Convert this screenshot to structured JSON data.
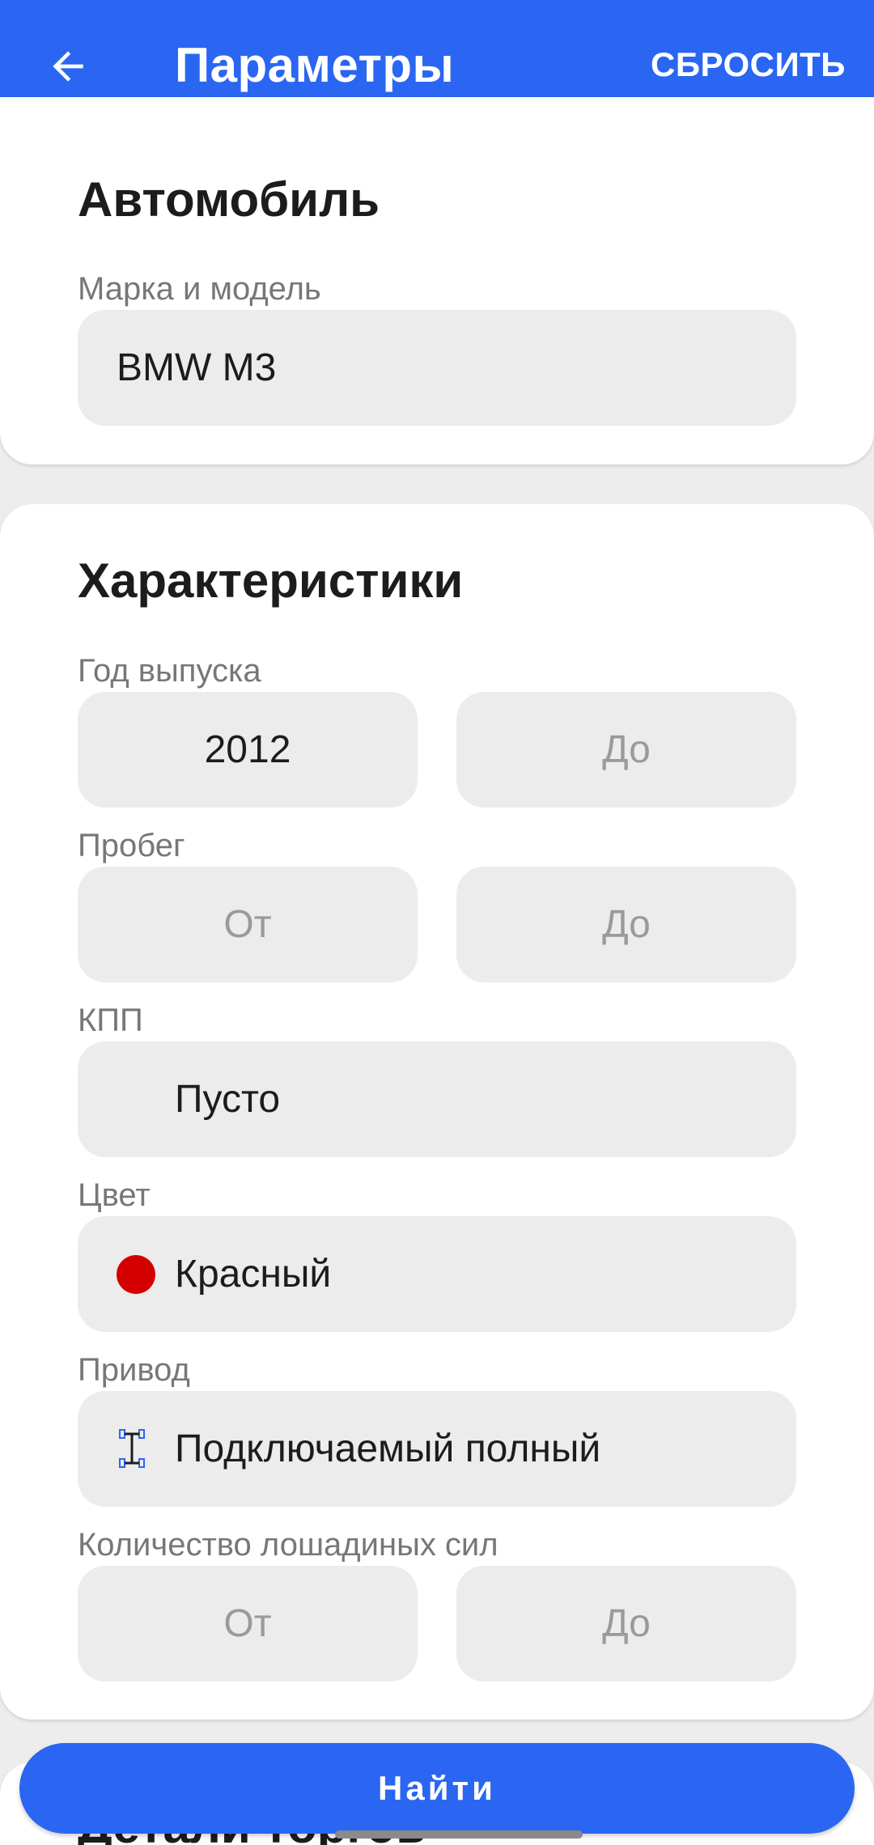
{
  "header": {
    "title": "Параметры",
    "reset_label": "СБРОСИТЬ"
  },
  "car_section": {
    "title": "Автомобиль",
    "make_model_label": "Марка и модель",
    "make_model_value": "BMW M3"
  },
  "specs_section": {
    "title": "Характеристики",
    "year": {
      "label": "Год выпуска",
      "from_value": "2012",
      "to_placeholder": "До"
    },
    "mileage": {
      "label": "Пробег",
      "from_placeholder": "От",
      "to_placeholder": "До"
    },
    "transmission": {
      "label": "КПП",
      "value": "Пусто"
    },
    "color": {
      "label": "Цвет",
      "value": "Красный",
      "swatch": "#d40000"
    },
    "drive": {
      "label": "Привод",
      "value": "Подключаемый полный",
      "icon": "drivetrain-icon"
    },
    "horsepower": {
      "label": "Количество лошадиных сил",
      "from_placeholder": "От",
      "to_placeholder": "До"
    }
  },
  "auction_section": {
    "title": "Детали торгов"
  },
  "find_button": {
    "label": "Найти"
  },
  "colors": {
    "accent": "#2a66f2",
    "field_bg": "#ececec",
    "page_bg": "#ededed"
  }
}
